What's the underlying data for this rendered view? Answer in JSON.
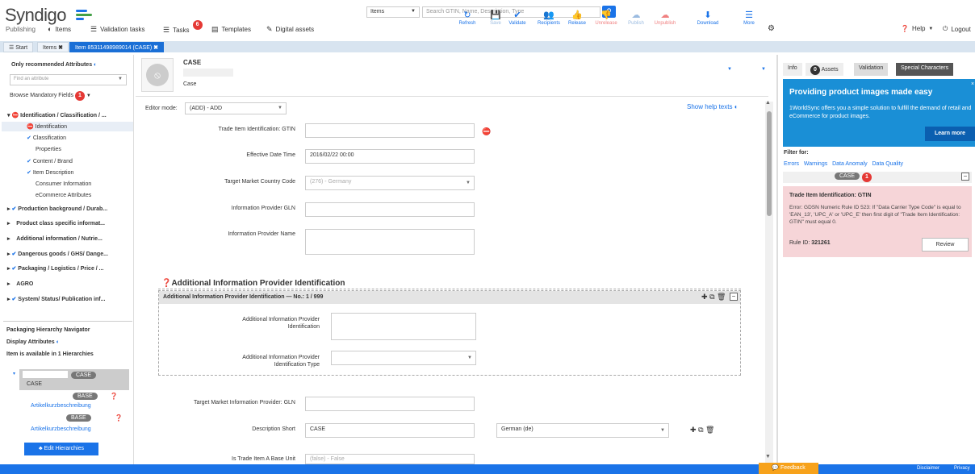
{
  "header": {
    "logo": "Syndigo",
    "logo_sub": "Publishing",
    "search_category": "Items",
    "search_placeholder": "Search GTIN, Name, Description, Type",
    "nav": [
      {
        "label": "Items"
      },
      {
        "label": "Validation tasks"
      },
      {
        "label": "Tasks",
        "badge": "6"
      },
      {
        "label": "Templates"
      },
      {
        "label": "Digital assets"
      }
    ],
    "help": "Help",
    "logout": "Logout"
  },
  "tabs": {
    "start": "Start",
    "items": "Items",
    "item": "Item 85311498989014 (CASE)"
  },
  "left": {
    "only_recommended": "Only recommended Attributes",
    "find_placeholder": "Find an attribute",
    "browse_mandatory": "Browse Mandatory Fields",
    "mandatory_count": "1",
    "tree": [
      "Identification / Classification / ...",
      "Identification",
      "Classification",
      "Properties",
      "Content / Brand",
      "Item Description",
      "Consumer Information",
      "eCommerce Attributes",
      "Production background / Durab...",
      "Product class specific informat...",
      "Additional information / Nutrie...",
      "Dangerous goods / GHS/ Dange...",
      "Packaging / Logistics / Price / ...",
      "AGRO",
      "System/ Status/ Publication inf..."
    ],
    "pkg_nav": "Packaging Hierarchy Navigator",
    "display_attrs": "Display Attributes",
    "hier_available": "Item is available in 1 Hierarchies",
    "case_badge": "CASE",
    "case_label": "CASE",
    "base_badge": "BASE",
    "artikel": "Artikelkurzbeschreibung",
    "edit_hier": "Edit Hierarchies"
  },
  "item_header": {
    "title": "CASE",
    "subtitle": "Case",
    "tools": [
      "Refresh",
      "Save",
      "Validate",
      "Recipients",
      "Release",
      "Unrelease",
      "Publish",
      "Unpublish",
      "Download",
      "More"
    ]
  },
  "form": {
    "editor_mode_label": "Editor mode:",
    "editor_mode_value": "(ADD) - ADD",
    "show_help": "Show help texts",
    "gtin_label": "Trade Item Identification: GTIN",
    "eff_date_label": "Effective Date Time",
    "eff_date_value": "2016/02/22 00:00",
    "target_market_label": "Target Market Country Code",
    "target_market_value": "(276) - Germany",
    "info_provider_gln_label": "Information Provider GLN",
    "info_provider_name_label": "Information Provider Name",
    "section_title": "Additional Information Provider Identification",
    "section_bar": "Additional Information Provider Identification — No.: 1 / 999",
    "aip_id_label": "Additional Information Provider Identification",
    "aip_type_label": "Additional Information Provider Identification Type",
    "tm_provider_gln_label": "Target Market Information Provider: GLN",
    "desc_short_label": "Description Short",
    "desc_short_value": "CASE",
    "desc_lang": "German (de)",
    "base_unit_label": "Is Trade Item A Base Unit",
    "base_unit_value": "(false) - False"
  },
  "right": {
    "tabs": [
      "Info",
      "Assets",
      "Validation",
      "Special Characters"
    ],
    "assets_count": "0",
    "promo_title": "Providing product images made easy",
    "promo_text": "1WorldSync offers you a simple solution to fulfill the demand of retail and eCommerce for product images.",
    "promo_btn": "Learn more",
    "filter_for": "Filter for:",
    "filters": [
      "Errors",
      "Warnings",
      "Data Anomaly",
      "Data Quality"
    ],
    "case_tag": "CASE",
    "case_count": "1",
    "error_title": "Trade Item Identification: GTIN",
    "error_text": "Error: GDSN Numeric Rule ID 523: If \"Data Carrier Type Code\" is equal to 'EAN_13', 'UPC_A' or 'UPC_E' then first digit of \"Trade Item Identification: GTIN\" must equal 0.",
    "rule_id_label": "Rule ID:",
    "rule_id": "321261",
    "review": "Review"
  },
  "footer": {
    "feedback": "Feedback",
    "disclaimer": "Disclaimer",
    "privacy": "Privacy"
  },
  "colors": {
    "accent": "#1a73e8",
    "error": "#e53935",
    "promo": "#1a8fd6",
    "error_bg": "#f6d5d8"
  }
}
